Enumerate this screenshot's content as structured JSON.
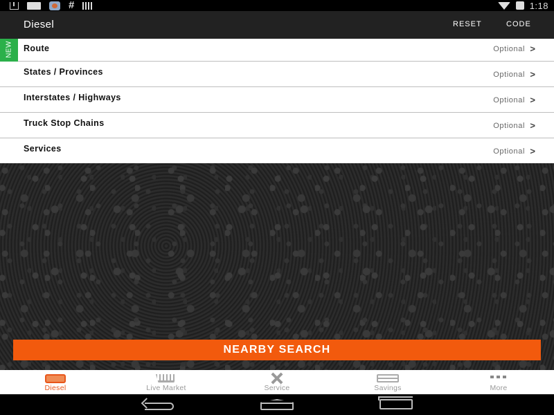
{
  "status_bar": {
    "left_icons": [
      "download-icon",
      "message-icon",
      "app-icon",
      "hash-icon",
      "signal-bars-icon"
    ],
    "hash_glyph": "#",
    "right_icons": [
      "wifi-icon",
      "battery-icon"
    ],
    "time": "1:18"
  },
  "app_bar": {
    "title": "Diesel",
    "reset_label": "RESET",
    "code_label": "CODE"
  },
  "filters": [
    {
      "label": "Route",
      "value": "Optional",
      "badge": "NEW"
    },
    {
      "label": "States / Provinces",
      "value": "Optional"
    },
    {
      "label": "Interstates / Highways",
      "value": "Optional"
    },
    {
      "label": "Truck Stop Chains",
      "value": "Optional"
    },
    {
      "label": "Services",
      "value": "Optional"
    }
  ],
  "chevron": ">",
  "nearby_search_label": "NEARBY SEARCH",
  "tabs": [
    {
      "label": "Diesel",
      "icon": "fuel-pump-icon",
      "active": true
    },
    {
      "label": "Live Market",
      "icon": "cart-icon",
      "active": false
    },
    {
      "label": "Service",
      "icon": "tools-icon",
      "active": false
    },
    {
      "label": "Savings",
      "icon": "card-icon",
      "active": false
    },
    {
      "label": "More",
      "icon": "more-icon",
      "active": false
    }
  ],
  "colors": {
    "accent": "#f25a0d",
    "new_badge": "#2bb04a",
    "app_bar": "#222222"
  }
}
